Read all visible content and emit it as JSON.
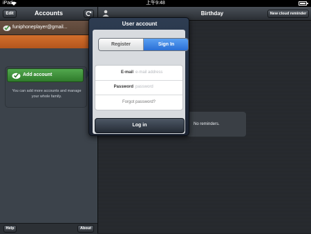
{
  "status_bar": {
    "carrier": "iPad",
    "wifi_icon": "wifi-icon",
    "time": "上午9:48",
    "battery_icon": "battery-icon"
  },
  "left_pane": {
    "header": {
      "edit_label": "Edit",
      "title": "Accounts",
      "refresh_icon": "refresh-icon"
    },
    "account": {
      "email": "funiphoneplayer@gmail...",
      "icon": "cloud-check-icon"
    },
    "add_account": {
      "label": "Add account",
      "icon": "cloud-check-icon",
      "description": "You can add more accounts and manage your whole family."
    },
    "footer": {
      "help_label": "Help",
      "about_label": "About"
    }
  },
  "right_pane": {
    "header": {
      "person_icon": "person-icon",
      "title": "Birthday",
      "new_reminder_label": "New cloud reminder"
    },
    "empty_text": "No reminders."
  },
  "popover": {
    "title": "User account",
    "segments": {
      "register": "Register",
      "sign_in": "Sign In",
      "selected": "Sign In"
    },
    "email": {
      "label": "E-mail",
      "placeholder": "e-mail address"
    },
    "password": {
      "label": "Password",
      "placeholder": "password"
    },
    "forgot_label": "Forgot password?",
    "login_label": "Log in"
  },
  "colors": {
    "accent_orange": "#d36f2c",
    "accent_blue": "#2a6fd6",
    "accent_green": "#3f913b"
  }
}
